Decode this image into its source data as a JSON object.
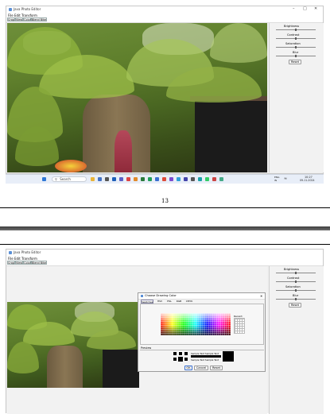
{
  "window1": {
    "title": "Java Photo Editor",
    "menu": [
      "File",
      "Edit",
      "Transform"
    ],
    "tabs": [
      "Crop",
      "View",
      "Color",
      "Blend Bike"
    ],
    "controls": {
      "minimize": "–",
      "maximize": "□",
      "close": "✕"
    }
  },
  "panel1": {
    "sliders": [
      {
        "label": "Brightness",
        "level": 0.5
      },
      {
        "label": "Contrast",
        "level": 0.5
      },
      {
        "label": "Saturation",
        "level": 0.5
      },
      {
        "label": "Blur",
        "level": 0.5
      }
    ],
    "reset_label": "Reset"
  },
  "taskbar": {
    "search_placeholder": "Search",
    "language": "ENG\nIN",
    "time": "10:27",
    "date": "09-11-2024",
    "icon_names": [
      "windows-start-icon",
      "search-icon",
      "file-explorer-icon",
      "browser-icon",
      "store-icon",
      "mail-icon",
      "teams-icon",
      "vscode-icon",
      "java-icon",
      "terminal-icon",
      "settings-icon",
      "edge-icon",
      "chrome-icon",
      "photos-icon"
    ]
  },
  "page_number": "13",
  "window2": {
    "title": "Java Photo Editor",
    "menu": [
      "File",
      "Edit",
      "Transform"
    ],
    "tabs": [
      "Crop",
      "View",
      "Color",
      "Blend Bike"
    ]
  },
  "panel2": {
    "sliders": [
      {
        "label": "Brightness",
        "level": 0.5
      },
      {
        "label": "Contrast",
        "level": 0.5
      },
      {
        "label": "Saturation",
        "level": 0.5
      },
      {
        "label": "Blur",
        "level": 0.5
      }
    ],
    "reset_label": "Reset"
  },
  "dialog": {
    "title": "Choose Drawing Color",
    "tabs": [
      "Swatches",
      "HSV",
      "HSL",
      "RGB",
      "CMYK"
    ],
    "recent_label": "Recent:",
    "preview_label": "Preview",
    "sample_text": "Sample Text  Sample Text",
    "sample_text_2": "Sample Text  Sample Text",
    "buttons": {
      "ok": "OK",
      "cancel": "Cancel",
      "reset": "Reset"
    },
    "close": "✕"
  }
}
